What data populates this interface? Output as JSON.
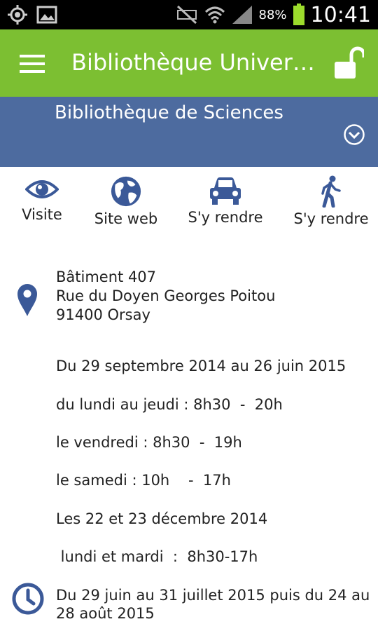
{
  "status_bar": {
    "battery": "88%",
    "time": "10:41"
  },
  "app_bar": {
    "title": "Bibliothèque Universi…"
  },
  "library": {
    "name": "Bibliothèque de Sciences"
  },
  "actions": [
    {
      "label": "Visite"
    },
    {
      "label": "Site web"
    },
    {
      "label": "S'y rendre"
    },
    {
      "label": "S'y rendre"
    }
  ],
  "address": {
    "line1": "Bâtiment 407",
    "line2": "Rue du Doyen Georges Poitou",
    "line3": "91400 Orsay"
  },
  "hours": [
    "Du 29 septembre 2014 au 26 juin 2015",
    "du lundi au jeudi : 8h30  -  20h",
    "le vendredi : 8h30  -  19h",
    "le samedi : 10h    -  17h",
    "Les 22 et 23 décembre 2014",
    " lundi et mardi  :  8h30-17h",
    "Du 29 juin au 31 juillet 2015 puis du 24 au",
    "28 août 2015"
  ],
  "colors": {
    "app_bar": "#7cbf32",
    "sub_header": "#4d6b9f",
    "icon_blue": "#3b5998"
  }
}
